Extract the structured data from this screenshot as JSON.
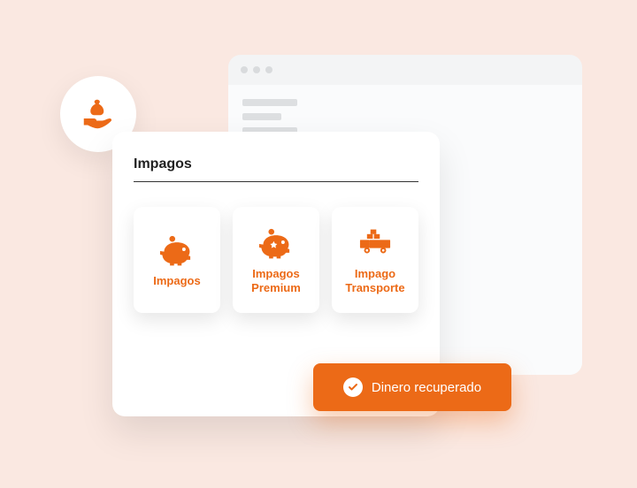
{
  "colors": {
    "accent": "#ec6a17"
  },
  "card": {
    "title": "Impagos",
    "tiles": [
      {
        "label": "Impagos",
        "icon": "piggy-bank"
      },
      {
        "label": "Impagos Premium",
        "icon": "piggy-bank-star"
      },
      {
        "label": "Impago Transporte",
        "icon": "truck"
      }
    ]
  },
  "circle_icon": "hand-money-bag",
  "badge": {
    "label": "Dinero recuperado",
    "icon": "check-circle"
  }
}
